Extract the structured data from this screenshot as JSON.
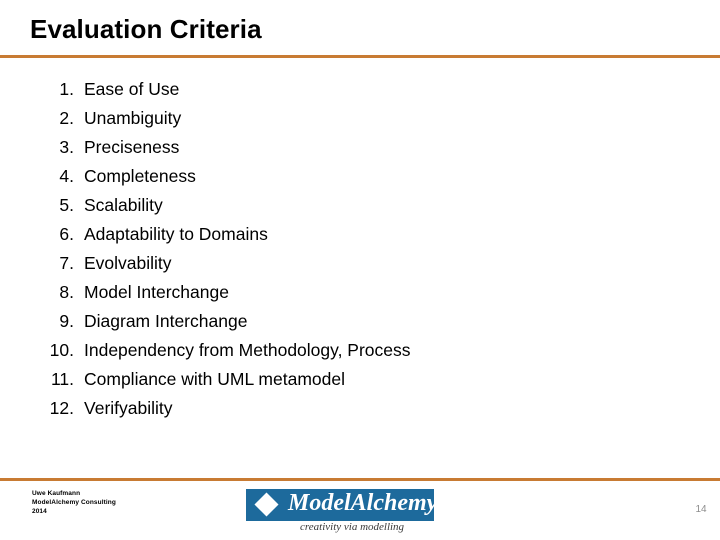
{
  "slide": {
    "title": "Evaluation Criteria",
    "accent_color": "#C87B33",
    "background_color": "#FFFFFF",
    "text_color": "#000000"
  },
  "criteria": [
    {
      "number": "1.",
      "label": "Ease of Use"
    },
    {
      "number": "2.",
      "label": "Unambiguity"
    },
    {
      "number": "3.",
      "label": "Preciseness"
    },
    {
      "number": "4.",
      "label": "Completeness"
    },
    {
      "number": "5.",
      "label": "Scalability"
    },
    {
      "number": "6.",
      "label": "Adaptability to Domains"
    },
    {
      "number": "7.",
      "label": "Evolvability"
    },
    {
      "number": "8.",
      "label": "Model Interchange"
    },
    {
      "number": "9.",
      "label": "Diagram Interchange"
    },
    {
      "number": "10.",
      "label": "Independency from Methodology, Process"
    },
    {
      "number": "11.",
      "label": "Compliance with UML metamodel"
    },
    {
      "number": "12.",
      "label": "Verifyability"
    }
  ],
  "footer": {
    "credit_line1": "Uwe Kaufmann",
    "credit_line2": "ModelAlchemy Consulting",
    "credit_line3": "2014",
    "page_number": "14",
    "page_number_color": "#8C8C8C",
    "logo": {
      "wordmark": "ModelAlchemy",
      "tagline": "creativity via modelling",
      "box_color": "#1D6A9C",
      "diamond_icon": "diamond-icon"
    }
  }
}
